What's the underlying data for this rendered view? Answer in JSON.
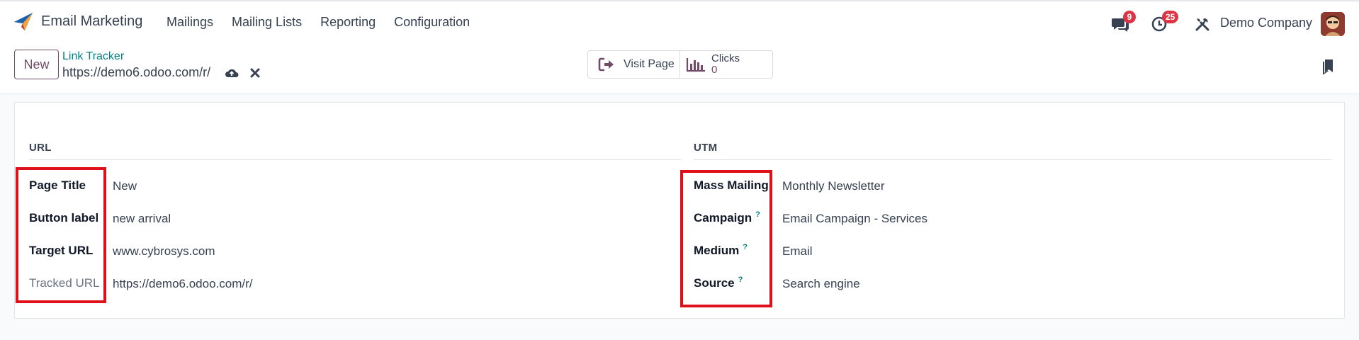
{
  "navbar": {
    "app_title": "Email Marketing",
    "menu": [
      "Mailings",
      "Mailing Lists",
      "Reporting",
      "Configuration"
    ],
    "messages_count": "9",
    "activities_count": "25",
    "company": "Demo Company",
    "icons": [
      "paper-plane-icon",
      "chat-icon",
      "clock-icon",
      "tools-icon",
      "avatar"
    ]
  },
  "control": {
    "new_label": "New",
    "breadcrumb": "Link Tracker",
    "record_name": "https://demo6.odoo.com/r/",
    "visit_label": "Visit Page",
    "clicks_label": "Clicks",
    "clicks_value": "0"
  },
  "form": {
    "url_group": {
      "title": "URL",
      "fields": [
        {
          "label": "Page Title",
          "value": "New"
        },
        {
          "label": "Button label",
          "value": "new arrival"
        },
        {
          "label": "Target URL",
          "value": "www.cybrosys.com"
        },
        {
          "label": "Tracked URL",
          "value": "https://demo6.odoo.com/r/"
        }
      ]
    },
    "utm_group": {
      "title": "UTM",
      "fields": [
        {
          "label": "Mass Mailing",
          "value": "Monthly Newsletter",
          "help": ""
        },
        {
          "label": "Campaign",
          "value": "Email Campaign - Services",
          "help": "?"
        },
        {
          "label": "Medium",
          "value": "Email",
          "help": "?"
        },
        {
          "label": "Source",
          "value": "Search engine",
          "help": "?"
        }
      ]
    }
  },
  "colors": {
    "brand": "#714b67",
    "link": "#017e84",
    "badge": "#dc3545",
    "highlight": "#e0101b"
  }
}
